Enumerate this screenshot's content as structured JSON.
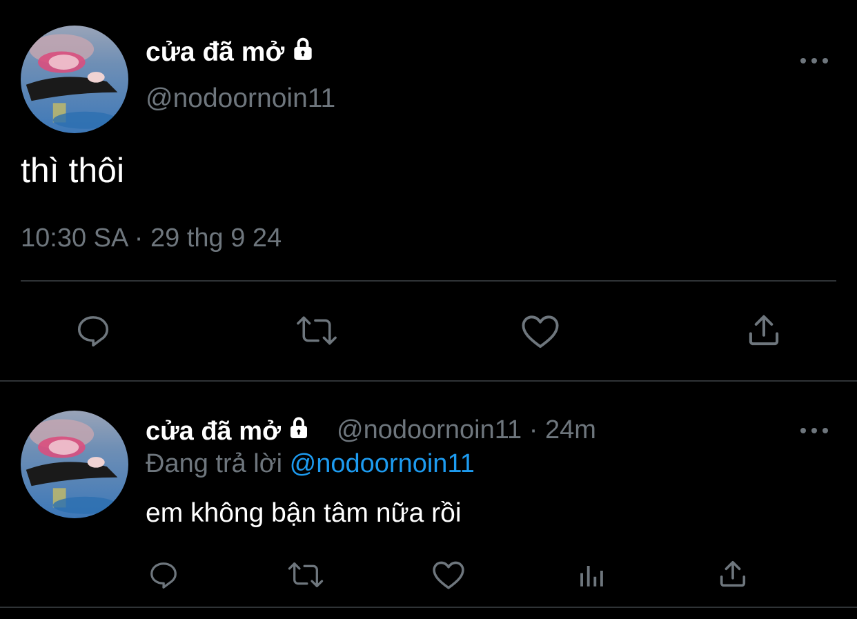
{
  "main_tweet": {
    "display_name": "cửa đã mở",
    "handle": "@nodoornoin11",
    "text": "thì thôi",
    "timestamp": "10:30 SA · 29 thg 9 24",
    "icons": [
      "lock-icon",
      "more-icon",
      "reply-icon",
      "retweet-icon",
      "like-icon",
      "share-icon"
    ]
  },
  "reply_tweet": {
    "display_name": "cửa đã mở",
    "handle_time": "@nodoornoin11 · 24m",
    "replying_prefix": "Đang trả lời",
    "replying_to": "@nodoornoin11",
    "text": "em không bận tâm nữa rồi",
    "icons": [
      "lock-icon",
      "more-icon",
      "reply-icon",
      "retweet-icon",
      "like-icon",
      "analytics-icon",
      "share-icon"
    ]
  },
  "colors": {
    "background": "#000000",
    "text_primary": "#ffffff",
    "text_secondary": "#6e767d",
    "mention": "#1d9bf0",
    "divider": "#2f3336"
  }
}
